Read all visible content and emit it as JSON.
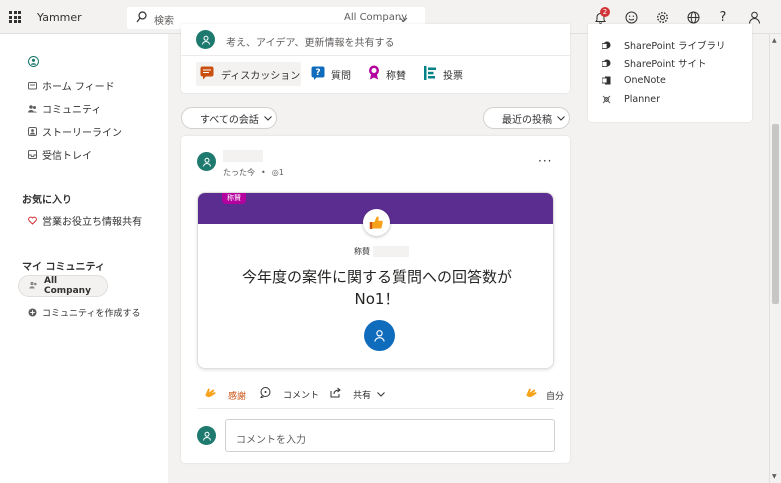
{
  "app": {
    "title": "Yammer"
  },
  "search": {
    "placeholder": "検索",
    "scope": "All Company"
  },
  "header": {
    "notification_count": "2"
  },
  "nav": {
    "items": [
      {
        "label": "ホーム フィード"
      },
      {
        "label": "コミュニティ"
      },
      {
        "label": "ストーリーライン"
      },
      {
        "label": "受信トレイ"
      }
    ],
    "favorites_heading": "お気に入り",
    "favorites": [
      {
        "label": "営業お役立ち情報共有"
      }
    ],
    "my_communities_heading": "マイ コミュニティ",
    "community": "All Company",
    "create_community": "コミュニティを作成する"
  },
  "composer": {
    "placeholder": "考え、アイデア、更新情報を共有する",
    "tabs": [
      {
        "label": "ディスカッション"
      },
      {
        "label": "質問"
      },
      {
        "label": "称賛"
      },
      {
        "label": "投票"
      }
    ]
  },
  "filters": {
    "conversations": "すべての会話",
    "sort": "最近の投稿"
  },
  "post": {
    "time": "たった今",
    "seen": "1",
    "praise_tag": "称賛",
    "praise_label": "称賛",
    "message": "今年度の案件に関する質問への回答数がNo1！",
    "actions": {
      "thanks": "感謝",
      "comment": "コメント",
      "share": "共有",
      "self": "自分"
    },
    "comment_placeholder": "コメントを入力"
  },
  "apps": {
    "items": [
      {
        "label": "SharePoint ライブラリ"
      },
      {
        "label": "SharePoint サイト"
      },
      {
        "label": "OneNote"
      },
      {
        "label": "Planner"
      }
    ]
  },
  "colors": {
    "teal": "#1e7a6e",
    "purple": "#5c2d91",
    "praise_tag": "#b4009e",
    "orange": "#ca5010",
    "blue": "#0f6cbd"
  }
}
